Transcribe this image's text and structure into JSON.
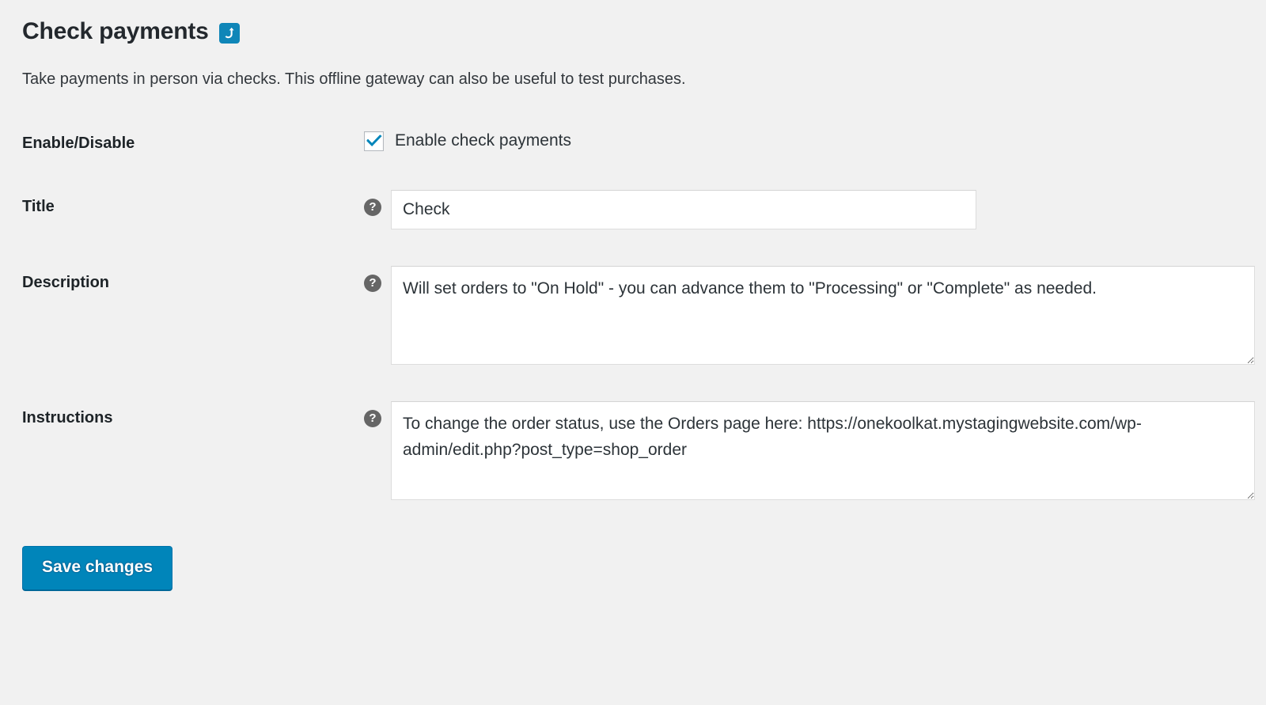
{
  "header": {
    "title": "Check payments",
    "badge_icon": "curved-up-arrow-icon",
    "badge_color": "#0f86b8",
    "subtitle": "Take payments in person via checks. This offline gateway can also be useful to test purchases."
  },
  "form": {
    "rows": [
      {
        "label": "Enable/Disable",
        "type": "checkbox",
        "checkbox_label": "Enable check payments",
        "checked": true,
        "has_help_tip": false
      },
      {
        "label": "Title",
        "type": "text",
        "value": "Check",
        "placeholder": "",
        "has_help_tip": true,
        "help_tip_icon": "question-mark-icon",
        "help_tip_glyph": "?"
      },
      {
        "label": "Description",
        "type": "textarea",
        "value": "Will set orders to \"On Hold\" - you can advance them to \"Processing\" or \"Complete\" as needed.",
        "placeholder": "",
        "has_help_tip": true,
        "help_tip_icon": "question-mark-icon",
        "help_tip_glyph": "?"
      },
      {
        "label": "Instructions",
        "type": "textarea",
        "value": "To change the order status, use the Orders page here: https://onekoolkat.mystagingwebsite.com/wp-admin/edit.php?post_type=shop_order",
        "placeholder": "",
        "has_help_tip": true,
        "help_tip_icon": "question-mark-icon",
        "help_tip_glyph": "?"
      }
    ]
  },
  "submit": {
    "save_label": "Save changes",
    "button_color": "#0085ba"
  },
  "colors": {
    "background": "#f1f1f1",
    "accent": "#0085ba",
    "badge": "#0f86b8",
    "check": "#0085ba",
    "label_text": "#1d2327",
    "body_text": "#32373c",
    "field_border": "#dddddd",
    "help_circle": "#666666"
  }
}
